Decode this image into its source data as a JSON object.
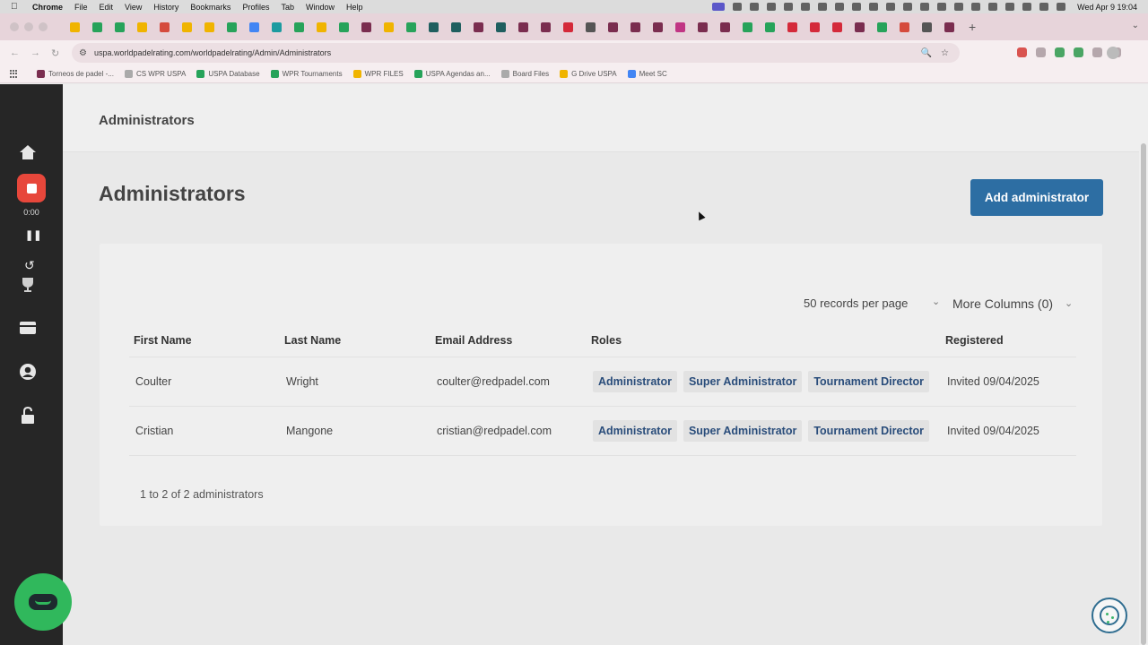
{
  "menubar": {
    "app_name": "Chrome",
    "items": [
      "File",
      "Edit",
      "View",
      "History",
      "Bookmarks",
      "Profiles",
      "Tab",
      "Window",
      "Help"
    ],
    "clock": "Wed Apr 9  19:04"
  },
  "browser": {
    "url": "uspa.worldpadelrating.com/worldpadelrating/Admin/Administrators",
    "tab_colors": [
      "#f0b400",
      "#27a35a",
      "#27a35a",
      "#f0b400",
      "#d54b3d",
      "#f0b400",
      "#f0b400",
      "#27a35a",
      "#4285f4",
      "#1c9ba0",
      "#27a35a",
      "#f0b400",
      "#27a35a",
      "#7a2d4f",
      "#f0b400",
      "#27a35a",
      "#1f5f5f",
      "#1f5f5f",
      "#7a2d4f",
      "#1f5f5f",
      "#7a2d4f",
      "#7a2d4f",
      "#d42a3a",
      "#555555",
      "#7a2d4f",
      "#7a2d4f",
      "#7a2d4f",
      "#c13584",
      "#7a2d4f",
      "#7a2d4f",
      "#27a35a",
      "#27a35a",
      "#d42a3a",
      "#d42a3a",
      "#d42a3a",
      "#7a2d4f",
      "#27a35a",
      "#d54b3d",
      "#555555",
      "#7a2d4f"
    ],
    "bookmarks": [
      {
        "label": "Torneos de padel -...",
        "color": "#7a2d4f"
      },
      {
        "label": "CS WPR USPA",
        "color": "#aaaaaa"
      },
      {
        "label": "USPA Database",
        "color": "#27a35a"
      },
      {
        "label": "WPR Tournaments",
        "color": "#27a35a"
      },
      {
        "label": "WPR FILES",
        "color": "#f0b400"
      },
      {
        "label": "USPA Agendas an...",
        "color": "#27a35a"
      },
      {
        "label": "Board Files",
        "color": "#aaaaaa"
      },
      {
        "label": "G Drive USPA",
        "color": "#f0b400"
      },
      {
        "label": "Meet SC",
        "color": "#4285f4"
      }
    ]
  },
  "recorder": {
    "time": "0:00"
  },
  "page": {
    "header_title": "Administrators",
    "heading": "Administrators",
    "add_button": "Add administrator"
  },
  "table": {
    "per_page": "50 records per page",
    "more_columns": "More Columns (0)",
    "columns": [
      "First Name",
      "Last Name",
      "Email Address",
      "Roles",
      "Registered"
    ],
    "rows": [
      {
        "first": "Coulter",
        "last": "Wright",
        "email": "coulter@redpadel.com",
        "roles": [
          "Administrator",
          "Super Administrator",
          "Tournament Director"
        ],
        "registered": "Invited 09/04/2025"
      },
      {
        "first": "Cristian",
        "last": "Mangone",
        "email": "cristian@redpadel.com",
        "roles": [
          "Administrator",
          "Super Administrator",
          "Tournament Director"
        ],
        "registered": "Invited 09/04/2025"
      }
    ],
    "summary": "1 to 2 of 2 administrators"
  },
  "colors": {
    "accent": "#2d6ea3",
    "sidebar": "#262626",
    "record": "#e7473b",
    "chat": "#30b85c",
    "role_text": "#2a4d7b"
  }
}
